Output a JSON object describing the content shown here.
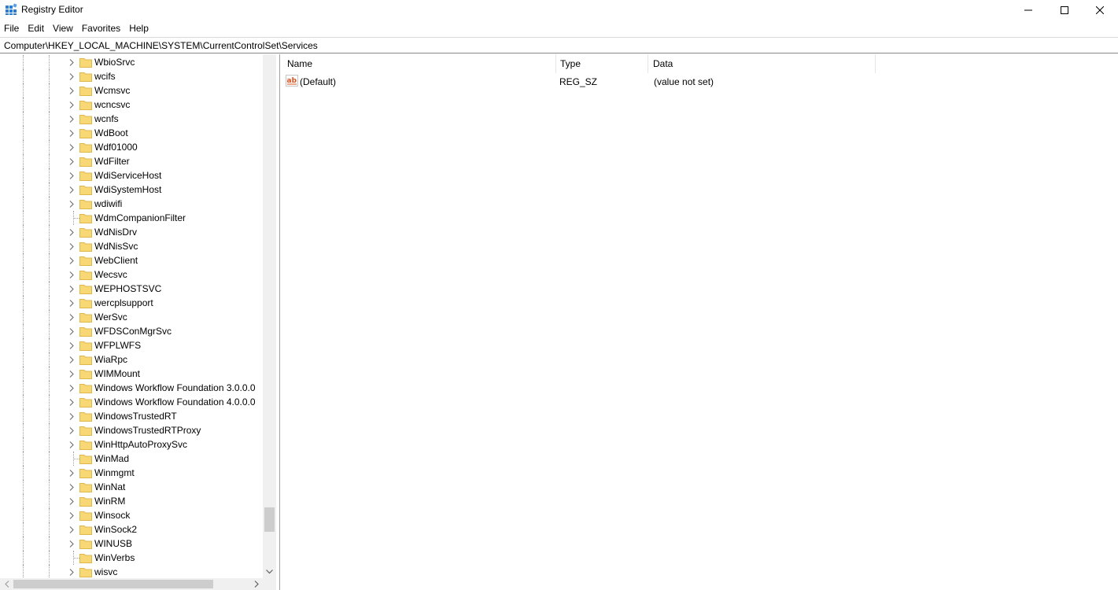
{
  "window": {
    "title": "Registry Editor",
    "minimize_glyph": "—",
    "maximize_glyph": "☐",
    "close_glyph": "✕"
  },
  "menu": [
    "File",
    "Edit",
    "View",
    "Favorites",
    "Help"
  ],
  "address": "Computer\\HKEY_LOCAL_MACHINE\\SYSTEM\\CurrentControlSet\\Services",
  "tree": {
    "items": [
      {
        "label": "WbioSrvc",
        "expandable": true
      },
      {
        "label": "wcifs",
        "expandable": true
      },
      {
        "label": "Wcmsvc",
        "expandable": true
      },
      {
        "label": "wcncsvc",
        "expandable": true
      },
      {
        "label": "wcnfs",
        "expandable": true
      },
      {
        "label": "WdBoot",
        "expandable": true
      },
      {
        "label": "Wdf01000",
        "expandable": true
      },
      {
        "label": "WdFilter",
        "expandable": true
      },
      {
        "label": "WdiServiceHost",
        "expandable": true
      },
      {
        "label": "WdiSystemHost",
        "expandable": true
      },
      {
        "label": "wdiwifi",
        "expandable": true
      },
      {
        "label": "WdmCompanionFilter",
        "expandable": false
      },
      {
        "label": "WdNisDrv",
        "expandable": true
      },
      {
        "label": "WdNisSvc",
        "expandable": true
      },
      {
        "label": "WebClient",
        "expandable": true
      },
      {
        "label": "Wecsvc",
        "expandable": true
      },
      {
        "label": "WEPHOSTSVC",
        "expandable": true
      },
      {
        "label": "wercplsupport",
        "expandable": true
      },
      {
        "label": "WerSvc",
        "expandable": true
      },
      {
        "label": "WFDSConMgrSvc",
        "expandable": true
      },
      {
        "label": "WFPLWFS",
        "expandable": true
      },
      {
        "label": "WiaRpc",
        "expandable": true
      },
      {
        "label": "WIMMount",
        "expandable": true
      },
      {
        "label": "Windows Workflow Foundation 3.0.0.0",
        "expandable": true
      },
      {
        "label": "Windows Workflow Foundation 4.0.0.0",
        "expandable": true
      },
      {
        "label": "WindowsTrustedRT",
        "expandable": true
      },
      {
        "label": "WindowsTrustedRTProxy",
        "expandable": true
      },
      {
        "label": "WinHttpAutoProxySvc",
        "expandable": true
      },
      {
        "label": "WinMad",
        "expandable": false
      },
      {
        "label": "Winmgmt",
        "expandable": true
      },
      {
        "label": "WinNat",
        "expandable": true
      },
      {
        "label": "WinRM",
        "expandable": true
      },
      {
        "label": "Winsock",
        "expandable": true
      },
      {
        "label": "WinSock2",
        "expandable": true
      },
      {
        "label": "WINUSB",
        "expandable": true
      },
      {
        "label": "WinVerbs",
        "expandable": false
      },
      {
        "label": "wisvc",
        "expandable": true
      }
    ],
    "scroll_position": 0.87
  },
  "values": {
    "columns": {
      "name": "Name",
      "type": "Type",
      "data": "Data"
    },
    "rows": [
      {
        "name": "(Default)",
        "type": "REG_SZ",
        "data": "(value not set)",
        "icon": "string-value-icon"
      }
    ]
  },
  "colors": {
    "folder": "#f8d775",
    "folder_dark": "#e0b84a",
    "reg_icon": "#d9531e"
  }
}
